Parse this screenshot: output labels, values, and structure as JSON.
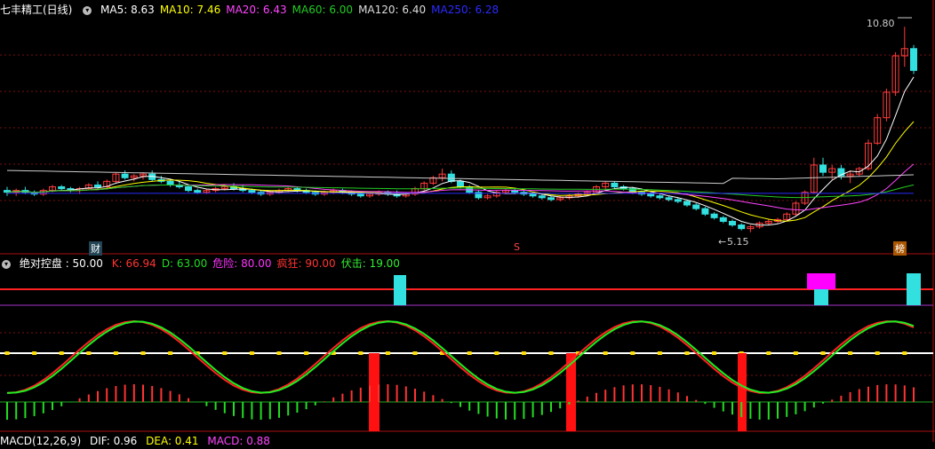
{
  "main": {
    "title": "七丰精工(日线)",
    "ma": [
      {
        "label": "MA5: 8.63",
        "color": "#ffffff"
      },
      {
        "label": "MA10: 7.46",
        "color": "#ffff00"
      },
      {
        "label": "MA20: 6.43",
        "color": "#ff44ff"
      },
      {
        "label": "MA60: 6.00",
        "color": "#22cc22"
      },
      {
        "label": "MA120: 6.40",
        "color": "#dddddd"
      },
      {
        "label": "MA250: 6.28",
        "color": "#2a2aff"
      }
    ],
    "high_label": "10.80",
    "low_label": "5.15",
    "tag_cai": "财",
    "tag_s": "S",
    "tag_bang": "榜"
  },
  "indicator": {
    "name": "绝对控盘",
    "value": ": 50.00",
    "params": [
      {
        "label": "K: 66.94",
        "color": "#ff3333"
      },
      {
        "label": "D: 63.00",
        "color": "#22dd22"
      },
      {
        "label": "危险: 80.00",
        "color": "#ff33ff"
      },
      {
        "label": "疯狂: 90.00",
        "color": "#ff3333"
      },
      {
        "label": "伏击: 19.00",
        "color": "#33ee33"
      }
    ]
  },
  "macd": {
    "label": "MACD(12,26,9)",
    "dif": "DIF: 0.96",
    "dea": "DEA: 0.41",
    "macd": "MACD: 0.88"
  },
  "colors": {
    "up": "#ff3b3b",
    "down": "#33e0e0",
    "k": "#ff2222",
    "d": "#22ee22",
    "danger": "#ff00ff",
    "grid": "#7a1010"
  },
  "chart_data": {
    "type": "candlestick",
    "candles": [
      [
        6.3,
        6.4,
        6.15,
        6.25
      ],
      [
        6.25,
        6.35,
        6.15,
        6.3
      ],
      [
        6.3,
        6.4,
        6.2,
        6.25
      ],
      [
        6.25,
        6.3,
        6.15,
        6.2
      ],
      [
        6.2,
        6.35,
        6.15,
        6.3
      ],
      [
        6.3,
        6.45,
        6.25,
        6.4
      ],
      [
        6.4,
        6.45,
        6.3,
        6.35
      ],
      [
        6.35,
        6.4,
        6.25,
        6.3
      ],
      [
        6.3,
        6.4,
        6.2,
        6.35
      ],
      [
        6.35,
        6.5,
        6.3,
        6.45
      ],
      [
        6.45,
        6.55,
        6.35,
        6.4
      ],
      [
        6.4,
        6.6,
        6.35,
        6.55
      ],
      [
        6.55,
        6.8,
        6.5,
        6.75
      ],
      [
        6.75,
        6.85,
        6.6,
        6.65
      ],
      [
        6.65,
        6.75,
        6.55,
        6.7
      ],
      [
        6.7,
        6.8,
        6.6,
        6.75
      ],
      [
        6.75,
        6.85,
        6.55,
        6.6
      ],
      [
        6.6,
        6.7,
        6.5,
        6.55
      ],
      [
        6.55,
        6.6,
        6.4,
        6.45
      ],
      [
        6.45,
        6.55,
        6.35,
        6.4
      ],
      [
        6.4,
        6.45,
        6.25,
        6.3
      ],
      [
        6.3,
        6.35,
        6.2,
        6.25
      ],
      [
        6.25,
        6.35,
        6.2,
        6.3
      ],
      [
        6.3,
        6.4,
        6.25,
        6.35
      ],
      [
        6.35,
        6.45,
        6.3,
        6.4
      ],
      [
        6.4,
        6.5,
        6.3,
        6.35
      ],
      [
        6.35,
        6.45,
        6.25,
        6.3
      ],
      [
        6.3,
        6.35,
        6.2,
        6.25
      ],
      [
        6.25,
        6.3,
        6.15,
        6.2
      ],
      [
        6.2,
        6.3,
        6.15,
        6.25
      ],
      [
        6.25,
        6.35,
        6.2,
        6.3
      ],
      [
        6.3,
        6.4,
        6.25,
        6.35
      ],
      [
        6.35,
        6.4,
        6.25,
        6.3
      ],
      [
        6.3,
        6.35,
        6.2,
        6.25
      ],
      [
        6.25,
        6.3,
        6.15,
        6.2
      ],
      [
        6.2,
        6.3,
        6.15,
        6.25
      ],
      [
        6.25,
        6.35,
        6.2,
        6.3
      ],
      [
        6.3,
        6.35,
        6.2,
        6.25
      ],
      [
        6.25,
        6.3,
        6.15,
        6.2
      ],
      [
        6.2,
        6.25,
        6.1,
        6.15
      ],
      [
        6.15,
        6.25,
        6.1,
        6.2
      ],
      [
        6.2,
        6.3,
        6.15,
        6.25
      ],
      [
        6.25,
        6.3,
        6.15,
        6.2
      ],
      [
        6.2,
        6.3,
        6.1,
        6.15
      ],
      [
        6.15,
        6.25,
        6.1,
        6.2
      ],
      [
        6.2,
        6.4,
        6.15,
        6.35
      ],
      [
        6.35,
        6.55,
        6.3,
        6.5
      ],
      [
        6.5,
        6.7,
        6.45,
        6.65
      ],
      [
        6.65,
        6.9,
        6.55,
        6.75
      ],
      [
        6.75,
        6.85,
        6.5,
        6.55
      ],
      [
        6.55,
        6.6,
        6.35,
        6.4
      ],
      [
        6.4,
        6.45,
        6.2,
        6.25
      ],
      [
        6.25,
        6.3,
        6.05,
        6.1
      ],
      [
        6.1,
        6.2,
        6.05,
        6.15
      ],
      [
        6.15,
        6.3,
        6.1,
        6.25
      ],
      [
        6.25,
        6.35,
        6.2,
        6.3
      ],
      [
        6.3,
        6.35,
        6.2,
        6.25
      ],
      [
        6.25,
        6.3,
        6.15,
        6.2
      ],
      [
        6.2,
        6.25,
        6.1,
        6.15
      ],
      [
        6.15,
        6.2,
        6.05,
        6.1
      ],
      [
        6.1,
        6.15,
        6.0,
        6.05
      ],
      [
        6.05,
        6.15,
        6.0,
        6.1
      ],
      [
        6.1,
        6.2,
        6.05,
        6.15
      ],
      [
        6.15,
        6.25,
        6.1,
        6.2
      ],
      [
        6.2,
        6.3,
        6.15,
        6.25
      ],
      [
        6.25,
        6.45,
        6.2,
        6.4
      ],
      [
        6.4,
        6.55,
        6.3,
        6.5
      ],
      [
        6.5,
        6.55,
        6.35,
        6.4
      ],
      [
        6.4,
        6.45,
        6.3,
        6.35
      ],
      [
        6.35,
        6.4,
        6.2,
        6.25
      ],
      [
        6.25,
        6.3,
        6.15,
        6.2
      ],
      [
        6.2,
        6.25,
        6.1,
        6.15
      ],
      [
        6.15,
        6.2,
        6.05,
        6.1
      ],
      [
        6.1,
        6.15,
        6.0,
        6.05
      ],
      [
        6.05,
        6.1,
        5.95,
        6.0
      ],
      [
        6.0,
        6.05,
        5.85,
        5.9
      ],
      [
        5.9,
        5.95,
        5.75,
        5.8
      ],
      [
        5.8,
        5.85,
        5.6,
        5.65
      ],
      [
        5.65,
        5.7,
        5.5,
        5.55
      ],
      [
        5.55,
        5.6,
        5.4,
        5.45
      ],
      [
        5.45,
        5.5,
        5.3,
        5.35
      ],
      [
        5.35,
        5.4,
        5.2,
        5.25
      ],
      [
        5.25,
        5.35,
        5.15,
        5.3
      ],
      [
        5.3,
        5.45,
        5.25,
        5.4
      ],
      [
        5.4,
        5.5,
        5.35,
        5.45
      ],
      [
        5.45,
        5.55,
        5.4,
        5.5
      ],
      [
        5.5,
        5.7,
        5.45,
        5.65
      ],
      [
        5.65,
        6.0,
        5.6,
        5.95
      ],
      [
        5.95,
        6.3,
        5.9,
        6.25
      ],
      [
        6.25,
        7.2,
        6.2,
        7.0
      ],
      [
        7.0,
        7.2,
        6.7,
        6.8
      ],
      [
        6.8,
        7.0,
        6.6,
        6.9
      ],
      [
        6.9,
        7.0,
        6.6,
        6.7
      ],
      [
        6.7,
        6.85,
        6.5,
        6.75
      ],
      [
        6.75,
        6.95,
        6.7,
        6.9
      ],
      [
        6.9,
        7.7,
        6.85,
        7.6
      ],
      [
        7.6,
        8.4,
        7.55,
        8.3
      ],
      [
        8.3,
        9.1,
        8.2,
        9.0
      ],
      [
        9.0,
        10.1,
        8.9,
        10.0
      ],
      [
        10.0,
        10.8,
        9.7,
        10.2
      ],
      [
        10.2,
        10.3,
        9.5,
        9.6
      ]
    ]
  }
}
